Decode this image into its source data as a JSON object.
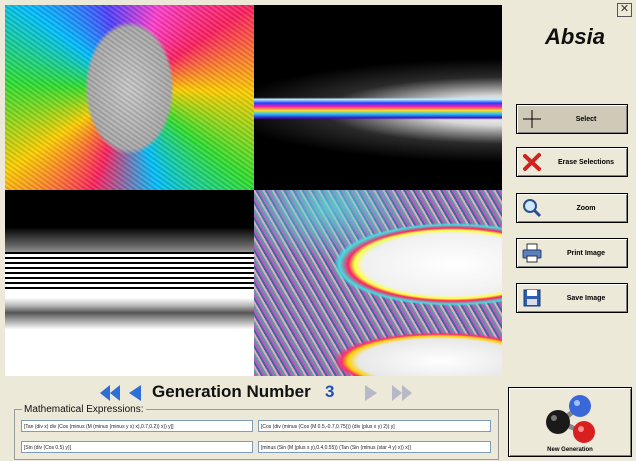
{
  "app": {
    "title": "Absia",
    "close_glyph": "✕"
  },
  "images": [
    {
      "name": "fractal-1"
    },
    {
      "name": "fractal-2"
    },
    {
      "name": "fractal-3"
    },
    {
      "name": "fractal-4"
    }
  ],
  "sidebar": {
    "select_label": "Select",
    "erase_label": "Erase Selections",
    "zoom_label": "Zoom",
    "print_label": "Print Image",
    "save_label": "Save Image"
  },
  "generation": {
    "label": "Generation Number",
    "number": "3",
    "icons": [
      "rewind-icon",
      "previous-icon",
      "next-icon",
      "fast-forward-icon"
    ]
  },
  "expressions": {
    "title": "Mathematical Expressions:",
    "items": [
      "[Tan (div x) div (Cos (minus (M (minus (minus y x) x),0.7,0.2)) x)) y]]",
      "[Cos (div (minus (Cos (M 0.5,-0.7,0.75))) (div (plus x y) 2)) y]",
      "[Sin (div (Cos 0.5) y)]",
      "[minus (Sin (M (plus x y),0.4,0.55)) (Tan (Sin (minus (star 4 y) x)) x)]"
    ]
  },
  "new_generation": {
    "label": "New Generation",
    "icon": "molecule-icon"
  },
  "colors": {
    "accent": "#1f4fbf",
    "panel": "#ece9d8"
  }
}
